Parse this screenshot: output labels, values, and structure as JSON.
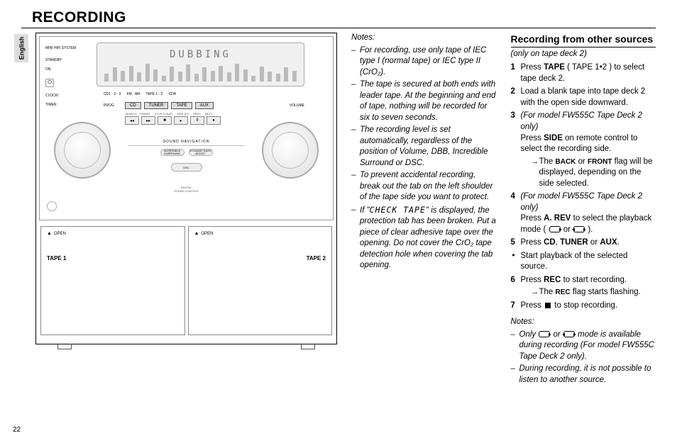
{
  "lang_tab": "English",
  "page_title": "RECORDING",
  "page_number": "22",
  "device": {
    "system_label": "MINI HIFI SYSTEM",
    "display_text": "DUBBING",
    "standby_on": "STANDBY\nON",
    "clock_timer": "CLOCK/\nTIMER",
    "mode_labels": [
      "CD1 · 2 · 3",
      "FM · AM",
      "TAPE 1 · 2",
      "CDR"
    ],
    "src_buttons": [
      "CD",
      "TUNER",
      "TAPE",
      "AUX"
    ],
    "prog": "PROG",
    "search": "SEARCH · TUNING",
    "stop_clear": "STOP·CLEAR",
    "play_pause": "PLAY / PAUSE",
    "prev": "PREV",
    "next": "NEXT",
    "volume": "VOLUME",
    "sound_nav": "SOUND NAVIGATION",
    "is": "INCREDIBLE\nSURROUND",
    "dbb": "DYNAMIC BASS\nBOOST",
    "dsc": "DIGITAL\nSOUND CONTROL",
    "dsc_short": "DSC",
    "open": "OPEN",
    "tape1": "TAPE 1",
    "tape2": "TAPE 2",
    "transport": [
      "◂◂",
      "▸▸",
      "■",
      "▸",
      "II",
      "●"
    ],
    "side_rev": "SIDE A·B\nA. REV"
  },
  "notes_head": "Notes:",
  "notes1": [
    "For recording, use only tape of IEC type I (normal tape) or IEC type II (CrO₂).",
    "The tape is secured at both ends with leader tape. At the beginning and end of tape, nothing will be recorded for six to seven seconds.",
    "The recording level is set automatically, regardless of the position of Volume, DBB, Incredible Surround or DSC.",
    "To prevent accidental recording, break out the tab on the left shoulder of the tape side you want to protect.",
    "If \"CHECK TAPE\" is displayed, the protection tab has been broken.  Put a piece of clear adhesive tape over the opening.  Do not cover the CrO₂ tape detection hole when covering the tab opening."
  ],
  "right": {
    "heading": "Recording from other sources",
    "only": "(only on tape deck 2)",
    "s1a": "Press ",
    "s1b": "TAPE",
    "s1c": " ( TAPE 1•2 ) to select tape deck 2.",
    "s2": "Load a blank tape into tape deck 2 with the open side downward.",
    "s3a": "(For model FW555C Tape Deck 2 only)",
    "s3b": "Press ",
    "s3c": "SIDE",
    "s3d": " on remote control to select the recording side.",
    "s3e1": "The ",
    "s3e2": "BACK",
    "s3e3": " or ",
    "s3e4": "FRONT",
    "s3e5": " flag will be displayed, depending on the side selected.",
    "s4a": "(For model FW555C Tape Deck 2 only)",
    "s4b": "Press ",
    "s4c": "A. REV",
    "s4d": " to select the playback mode ( ",
    "s4e": " or ",
    "s4f": " ).",
    "s5a": "Press ",
    "s5b": "CD",
    "s5c": ", ",
    "s5d": "TUNER",
    "s5e": " or ",
    "s5f": "AUX",
    "s5g": ".",
    "bullet": "Start playback of the selected source.",
    "s6a": "Press ",
    "s6b": "REC",
    "s6c": " to start recording.",
    "s6d1": "The ",
    "s6d2": "REC",
    "s6d3": " flag starts flashing.",
    "s7a": "Press ",
    "s7b": " to stop recording.",
    "notes2a": "Only ",
    "notes2b": " or ",
    "notes2c": " mode is available during recording (For model FW555C Tape Deck 2 only).",
    "notes2d": "During recording, it is not possible to listen to another source."
  }
}
